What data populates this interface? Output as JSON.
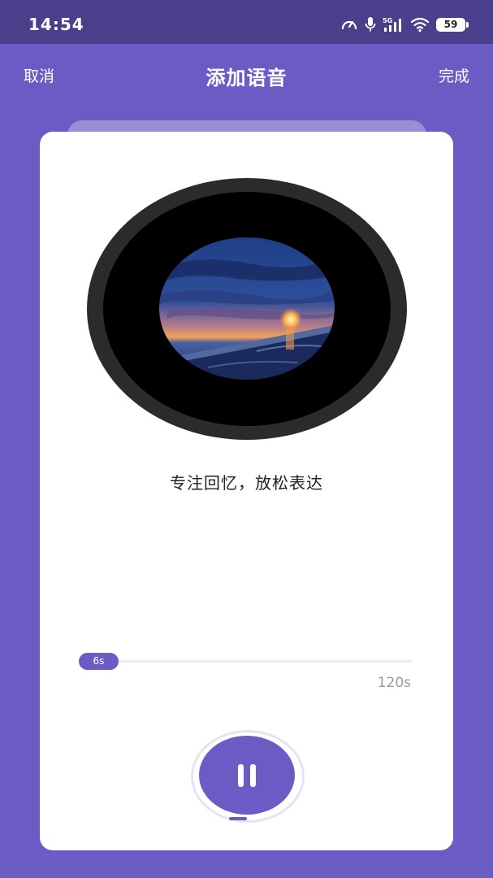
{
  "status_bar": {
    "time": "14:54",
    "network": "5G",
    "battery": "59",
    "icons": [
      "speed-meter-icon",
      "microphone-icon",
      "signal-icon",
      "wifi-icon",
      "battery-icon"
    ]
  },
  "nav": {
    "cancel_label": "取消",
    "title": "添加语音",
    "done_label": "完成"
  },
  "recorder": {
    "disc_image": "sunset-over-sea",
    "prompt": "专注回忆，放松表达",
    "elapsed_label": "6s",
    "max_label": "120s",
    "elapsed_seconds": 6,
    "max_seconds": 120,
    "state": "recording",
    "control_icon": "pause-icon"
  },
  "colors": {
    "accent": "#6b5bc4",
    "status_bar_bg": "#4a3f8a",
    "card_bg": "#ffffff",
    "back_card": "#9a8ed6",
    "disc_rim": "#2b2b2b",
    "disc_body": "#000000"
  }
}
